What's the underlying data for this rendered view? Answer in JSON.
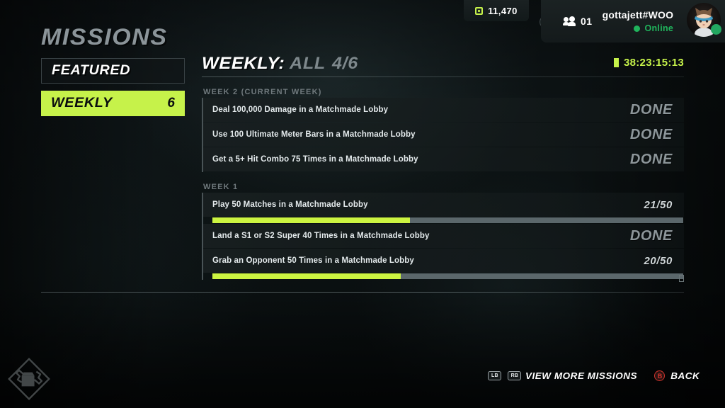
{
  "header": {
    "currency": {
      "icon": "coin-icon",
      "value": "11,470"
    },
    "badge_icon": "copy-badge-icon",
    "party": {
      "icon": "party-icon",
      "count": "01"
    },
    "player": {
      "name": "gottajett#WOO",
      "status": "Online",
      "status_color": "#20b45c",
      "avatar_icon": "player-avatar"
    }
  },
  "sidebar": {
    "title": "MISSIONS",
    "tabs": [
      {
        "label": "FEATURED",
        "count": "",
        "selected": false
      },
      {
        "label": "WEEKLY",
        "count": "6",
        "selected": true
      }
    ]
  },
  "content": {
    "title": "WEEKLY:",
    "filter": "ALL",
    "fraction": "4/6",
    "timer": {
      "icon": "hourglass-icon",
      "value": "38:23:15:13",
      "color": "#c6f24a"
    },
    "groups": [
      {
        "label": "WEEK 2 (CURRENT WEEK)",
        "missions": [
          {
            "text": "Deal 100,000 Damage in a Matchmade Lobby",
            "status": "DONE",
            "progress": null
          },
          {
            "text": "Use 100 Ultimate Meter Bars in a Matchmade Lobby",
            "status": "DONE",
            "progress": null
          },
          {
            "text": "Get a 5+ Hit Combo 75 Times in a Matchmade Lobby",
            "status": "DONE",
            "progress": null
          }
        ]
      },
      {
        "label": "WEEK 1",
        "missions": [
          {
            "text": "Play 50 Matches in a Matchmade Lobby",
            "status": "21/50",
            "progress": 42
          },
          {
            "text": "Land a S1 or S2 Super 40 Times in a Matchmade Lobby",
            "status": "DONE",
            "progress": null
          },
          {
            "text": "Grab an Opponent 50 Times in a Matchmade Lobby",
            "status": "20/50",
            "progress": 40
          }
        ]
      }
    ]
  },
  "footer": {
    "actions": [
      {
        "keys": [
          "LB",
          "RB"
        ],
        "label": "VIEW MORE MISSIONS"
      },
      {
        "keys": [
          "B"
        ],
        "label": "BACK",
        "key_style": "round-red"
      }
    ]
  },
  "colors": {
    "accent": "#c6f24a",
    "background": "#0b1011",
    "done_text": "#8d969a",
    "bar_track": "#5b676b"
  }
}
